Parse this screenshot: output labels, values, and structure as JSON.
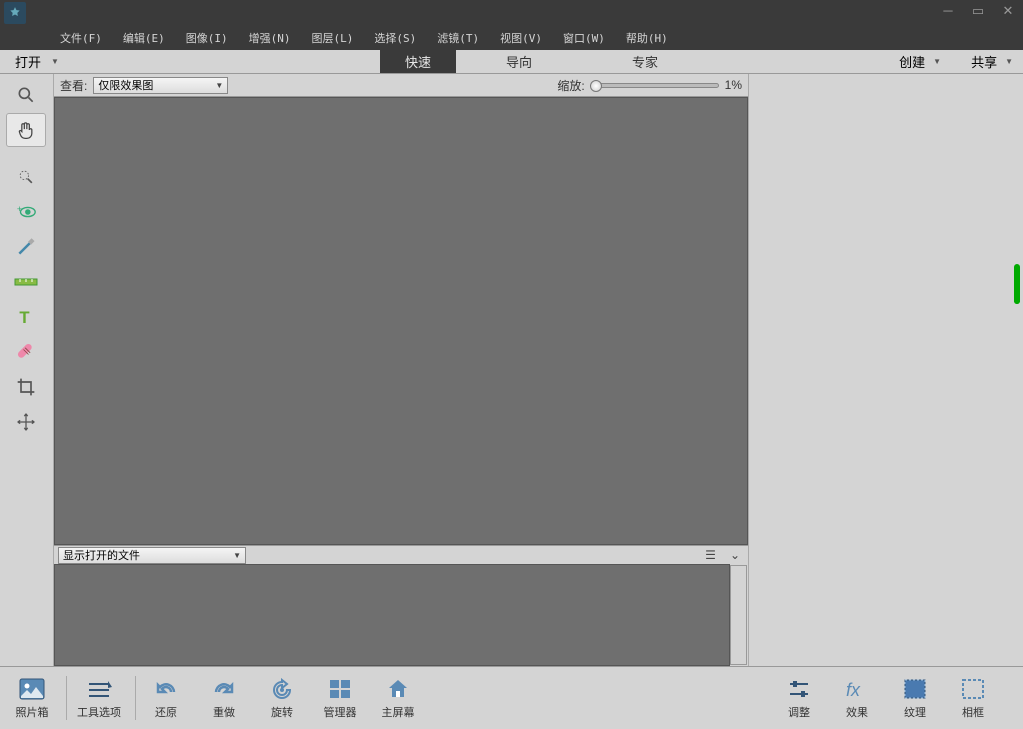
{
  "menu": {
    "file": "文件(F)",
    "edit": "编辑(E)",
    "image": "图像(I)",
    "enhance": "增强(N)",
    "layer": "图层(L)",
    "select": "选择(S)",
    "filter": "滤镜(T)",
    "view": "视图(V)",
    "window": "窗口(W)",
    "help": "帮助(H)"
  },
  "mode": {
    "open": "打开",
    "quick": "快速",
    "guide": "导向",
    "expert": "专家",
    "create": "创建",
    "share": "共享"
  },
  "opt": {
    "view_label": "查看:",
    "view_value": "仅限效果图",
    "zoom_label": "缩放:",
    "zoom_value": "1%"
  },
  "filebar": {
    "label": "显示打开的文件"
  },
  "bottom": {
    "photobin": "照片箱",
    "tooloptions": "工具选项",
    "undo": "还原",
    "redo": "重做",
    "rotate": "旋转",
    "organizer": "管理器",
    "home": "主屏幕",
    "adjust": "调整",
    "effects": "效果",
    "textures": "纹理",
    "frames": "相框"
  }
}
